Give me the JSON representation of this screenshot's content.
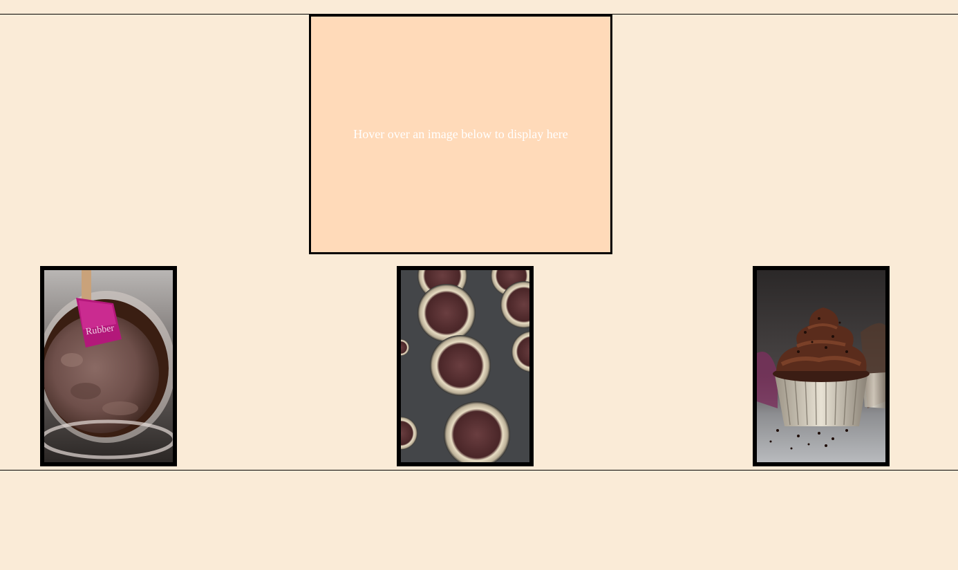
{
  "colors": {
    "page_background": "#FAEBD7",
    "display_background": "#FFDAB9",
    "display_text": "#FFFFFF",
    "border": "#000000"
  },
  "display": {
    "text": "Hover over an image below to display here"
  },
  "gallery": [
    {
      "alt": "chocolate cupcake batter in a glass bowl with a pink spatula"
    },
    {
      "alt": "cupcake liners filled with chocolate batter in a muffin pan"
    },
    {
      "alt": "chocolate cupcake with piped chocolate frosting and sprinkles"
    }
  ]
}
